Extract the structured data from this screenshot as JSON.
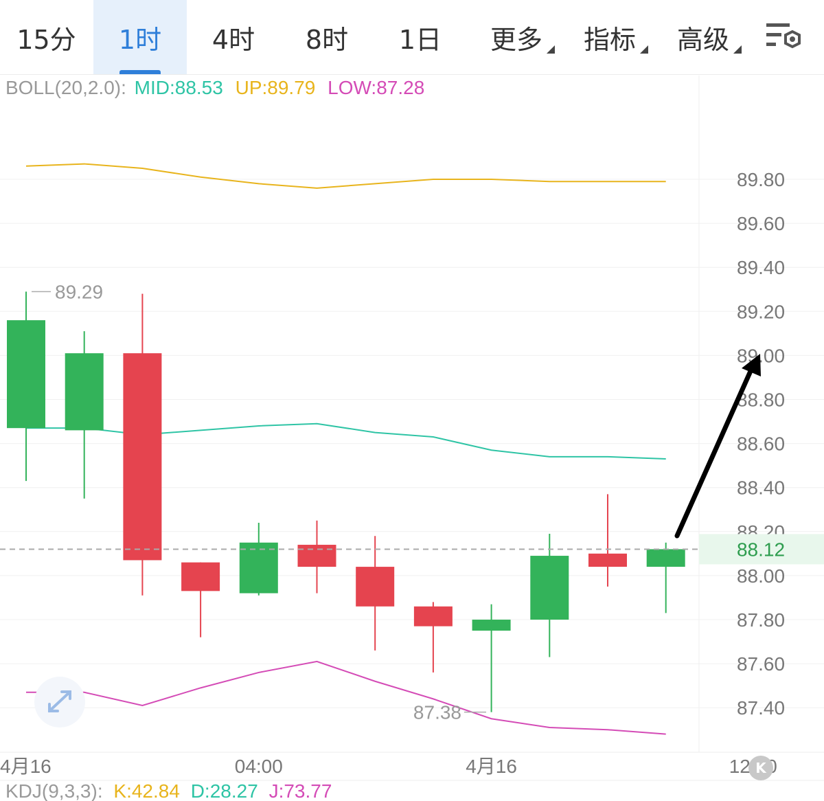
{
  "tabs": [
    {
      "label": "15分",
      "active": false,
      "dropdown": false
    },
    {
      "label": "1时",
      "active": true,
      "dropdown": false
    },
    {
      "label": "4时",
      "active": false,
      "dropdown": false
    },
    {
      "label": "8时",
      "active": false,
      "dropdown": false
    },
    {
      "label": "1日",
      "active": false,
      "dropdown": false
    },
    {
      "label": "更多",
      "active": false,
      "dropdown": true
    },
    {
      "label": "指标",
      "active": false,
      "dropdown": true
    },
    {
      "label": "高级",
      "active": false,
      "dropdown": true
    }
  ],
  "settings_icon": "chart-settings-icon",
  "legend": {
    "name": "BOLL(20,2.0):",
    "mid": "MID:88.53",
    "up": "UP:89.79",
    "low": "LOW:87.28"
  },
  "colors": {
    "accent": "#2f7fd9",
    "up_candle": "#33b35a",
    "down_candle": "#e5444f",
    "mid": "#2ec4a5",
    "upper": "#e8b41c",
    "lower": "#d44bb6",
    "legend_name": "#999999",
    "price_tag_bg": "#e8f7ec"
  },
  "chart_data": {
    "type": "candlestick",
    "y_axis": {
      "ticks": [
        "89.80",
        "89.60",
        "89.40",
        "89.20",
        "89.00",
        "88.80",
        "88.60",
        "88.40",
        "88.20",
        "88.00",
        "87.80",
        "87.60",
        "87.40"
      ],
      "range": [
        87.21,
        89.87
      ]
    },
    "x_axis": {
      "labels": [
        {
          "text": "4月16",
          "index": 0
        },
        {
          "text": "04:00",
          "index": 4
        },
        {
          "text": "4月16",
          "index": 8
        },
        {
          "text": "12:00",
          "index": 12.5
        }
      ]
    },
    "candles": [
      {
        "open": 88.67,
        "high": 89.29,
        "low": 88.43,
        "close": 89.16
      },
      {
        "open": 88.66,
        "high": 89.11,
        "low": 88.35,
        "close": 89.01
      },
      {
        "open": 89.01,
        "high": 89.28,
        "low": 87.91,
        "close": 88.07
      },
      {
        "open": 88.06,
        "high": 88.06,
        "low": 87.72,
        "close": 87.93
      },
      {
        "open": 87.92,
        "high": 88.24,
        "low": 87.91,
        "close": 88.15
      },
      {
        "open": 88.14,
        "high": 88.25,
        "low": 87.92,
        "close": 88.04
      },
      {
        "open": 88.04,
        "high": 88.18,
        "low": 87.66,
        "close": 87.86
      },
      {
        "open": 87.86,
        "high": 87.88,
        "low": 87.56,
        "close": 87.77
      },
      {
        "open": 87.75,
        "high": 87.87,
        "low": 87.38,
        "close": 87.8
      },
      {
        "open": 87.8,
        "high": 88.19,
        "low": 87.63,
        "close": 88.09
      },
      {
        "open": 88.1,
        "high": 88.37,
        "low": 87.95,
        "close": 88.04
      },
      {
        "open": 88.04,
        "high": 88.15,
        "low": 87.83,
        "close": 88.12
      }
    ],
    "boll_upper": [
      89.86,
      89.87,
      89.85,
      89.81,
      89.78,
      89.76,
      89.78,
      89.8,
      89.8,
      89.79,
      89.79,
      89.79
    ],
    "boll_mid": [
      88.67,
      88.67,
      88.64,
      88.66,
      88.68,
      88.69,
      88.65,
      88.63,
      88.57,
      88.54,
      88.54,
      88.53
    ],
    "boll_lower": [
      87.47,
      87.47,
      87.41,
      87.49,
      87.56,
      87.61,
      87.52,
      87.44,
      87.35,
      87.31,
      87.3,
      87.28
    ],
    "high_marker": "89.29",
    "low_marker": "87.38",
    "current_price": 88.12,
    "current_price_label": "88.12",
    "annotation": "hand-drawn arrow pointing up-right from last candle toward 89.00"
  },
  "kdj_strip": {
    "name": "KDJ(9,3,3):",
    "k": "K:42.84",
    "d": "D:28.27",
    "j": "J:73.77"
  },
  "k_badge": "K"
}
